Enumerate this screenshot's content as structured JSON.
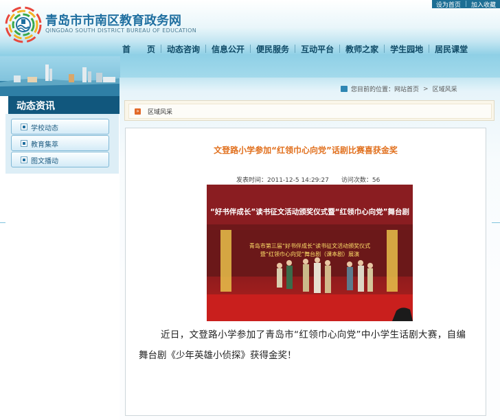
{
  "top_links": {
    "set_home": "设为首页",
    "separator": "|",
    "add_favorite": "加入收藏"
  },
  "site": {
    "title": "青岛市市南区教育政务网",
    "subtitle": "QINGDAO SOUTH DISTRICT BUREAU OF EDUCATION"
  },
  "nav": {
    "items": [
      {
        "label": "首　　页"
      },
      {
        "label": "动态咨询"
      },
      {
        "label": "信息公开"
      },
      {
        "label": "便民服务"
      },
      {
        "label": "互动平台"
      },
      {
        "label": "教师之家"
      },
      {
        "label": "学生园地"
      },
      {
        "label": "居民课堂"
      }
    ]
  },
  "sidebar": {
    "title": "动态资讯",
    "items": [
      {
        "label": "学校动态"
      },
      {
        "label": "教育集萃"
      },
      {
        "label": "图文播动"
      }
    ]
  },
  "breadcrumb": {
    "prefix": "您目前的位置：",
    "home": "网站首页",
    "separator": ">",
    "current": "区域风采"
  },
  "section": {
    "title": "区域风采"
  },
  "article": {
    "title": "文登路小学参加“红领巾心向党”话剧比赛喜获金奖",
    "published_label": "发表时间：",
    "published": "2011-12-5 14:29:27",
    "views_label": "访问次数：",
    "views": "56",
    "photo": {
      "banner": "“好书伴成长”读书征文活动颁奖仪式暨“红领巾心向党”舞台剧",
      "backdrop_line1": "青岛市第三届“好书伴成长”读书征文活动颁奖仪式",
      "backdrop_line2": "暨“红领巾心向党”舞台剧（课本剧）展演"
    },
    "body": "近日，文登路小学参加了青岛市“红领巾心向党”中小学生话剧大赛，自编舞台剧《少年英雄小侦探》获得金奖！"
  },
  "colors": {
    "header_blue": "#1f6fa0",
    "nav_text": "#0f4a66",
    "sidebar_title_bg": "#11577d",
    "article_title": "#e1701e",
    "section_marker": "#e26a2a"
  }
}
